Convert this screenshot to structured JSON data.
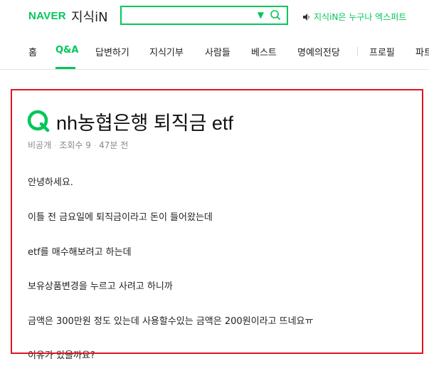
{
  "header": {
    "logo_naver": "NAVER",
    "logo_service": "지식iN",
    "search_placeholder": "",
    "expert_text": "지식iN은 누구나 엑스퍼트"
  },
  "nav": {
    "items": [
      "홈",
      "Q&A",
      "답변하기",
      "지식기부",
      "사람들",
      "베스트",
      "명예의전당",
      "프로필",
      "파트"
    ],
    "active": "Q&A"
  },
  "question": {
    "title": "nh농협은행 퇴직금 etf",
    "meta": [
      "비공개",
      "조회수 9",
      "47분 전"
    ],
    "body": [
      "안녕하세요.",
      "이틀 전 금요일에 퇴직금이라고 돈이 들어왔는데",
      "etf를 매수해보려고 하는데",
      "보유상품변경을 누르고 사려고 하니까",
      "금액은 300만원 정도 있는데 사용할수있는 금액은 200원이라고 뜨네요ㅠ",
      "이유가 있을까요?"
    ]
  },
  "colors": {
    "brand": "#03c75a",
    "highlight": "#e0161e"
  }
}
